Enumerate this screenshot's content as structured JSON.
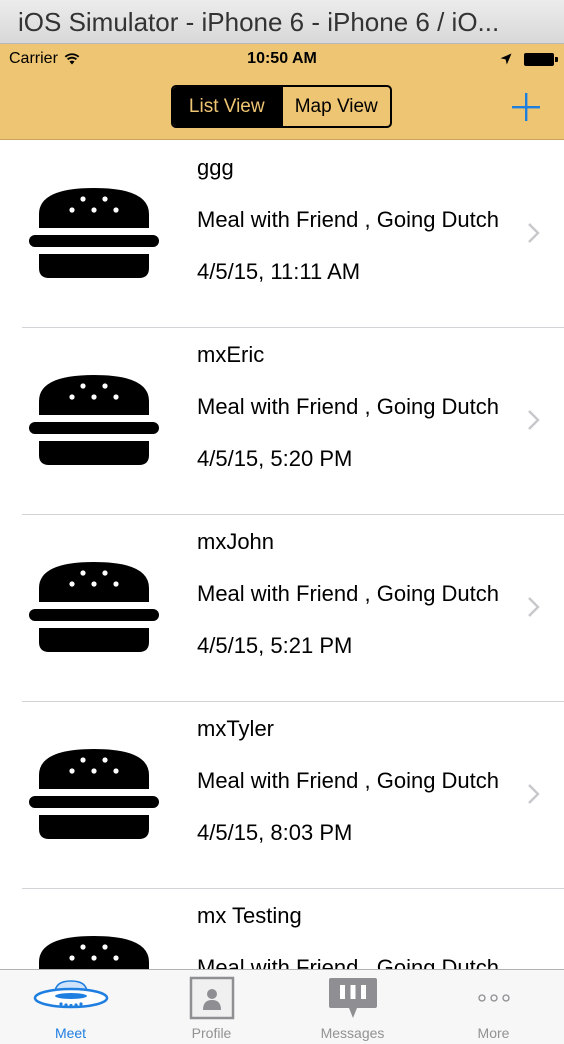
{
  "window": {
    "title": "iOS Simulator - iPhone 6 - iPhone 6 / iO..."
  },
  "status_bar": {
    "carrier": "Carrier",
    "time": "10:50 AM"
  },
  "nav": {
    "segments": [
      "List View",
      "Map View"
    ],
    "selected_segment": "List View",
    "add_button_icon": "plus-icon"
  },
  "colors": {
    "bar_background": "#eec573",
    "accent": "#1f7fe0",
    "separator": "#d4d4d8"
  },
  "meetups": [
    {
      "name": "ggg",
      "description": "Meal with Friend , Going Dutch",
      "date": "4/5/15, 11:11 AM",
      "icon": "burger-icon"
    },
    {
      "name": "mxEric",
      "description": "Meal with Friend , Going Dutch",
      "date": "4/5/15, 5:20 PM",
      "icon": "burger-icon"
    },
    {
      "name": "mxJohn",
      "description": "Meal with Friend , Going Dutch",
      "date": "4/5/15, 5:21 PM",
      "icon": "burger-icon"
    },
    {
      "name": "mxTyler",
      "description": "Meal with Friend , Going Dutch",
      "date": "4/5/15, 8:03 PM",
      "icon": "burger-icon"
    },
    {
      "name": "mx Testing",
      "description": "Meal with Friend , Going Dutch",
      "date": "",
      "icon": "burger-icon"
    }
  ],
  "tab_bar": {
    "tabs": [
      {
        "label": "Meet",
        "icon": "ufo-icon",
        "active": true
      },
      {
        "label": "Profile",
        "icon": "profile-icon",
        "active": false
      },
      {
        "label": "Messages",
        "icon": "messages-icon",
        "active": false
      },
      {
        "label": "More",
        "icon": "more-icon",
        "active": false
      }
    ]
  }
}
